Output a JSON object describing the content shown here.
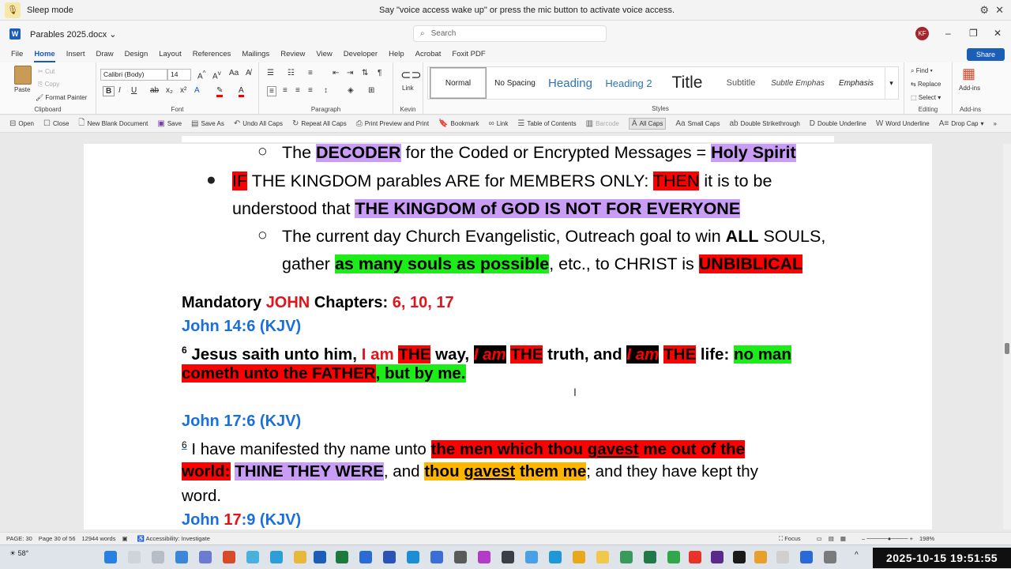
{
  "voice_access": {
    "status": "Sleep mode",
    "message": "Say \"voice access wake up\" or press the mic button to activate voice access."
  },
  "title_bar": {
    "filename": "Parables 2025.docx",
    "search_placeholder": "Search",
    "avatar": "KF"
  },
  "menu": [
    "File",
    "Home",
    "Insert",
    "Draw",
    "Design",
    "Layout",
    "References",
    "Mailings",
    "Review",
    "View",
    "Developer",
    "Help",
    "Acrobat",
    "Foxit PDF"
  ],
  "share": "Share",
  "ribbon": {
    "clipboard": {
      "paste": "Paste",
      "cut": "Cut",
      "copy": "Copy",
      "format_painter": "Format Painter",
      "label": "Clipboard"
    },
    "font": {
      "family": "Calibri (Body)",
      "size": "14",
      "label": "Font"
    },
    "paragraph": {
      "label": "Paragraph"
    },
    "kevin": {
      "link": "Link",
      "label": "Kevin"
    },
    "styles": {
      "items": [
        "Normal",
        "No Spacing",
        "Heading",
        "Heading 2",
        "Title",
        "Subtitle",
        "Subtle Emphas",
        "Emphasis"
      ],
      "label": "Styles"
    },
    "editing": {
      "find": "Find",
      "replace": "Replace",
      "select": "Select",
      "label": "Editing"
    },
    "addins": {
      "button": "Add-ins",
      "label": "Add-ins"
    }
  },
  "quick_access": [
    "Open",
    "Close",
    "New Blank Document",
    "Save",
    "Save As",
    "Undo All Caps",
    "Repeat All Caps",
    "Print Preview and Print",
    "Bookmark",
    "Link",
    "Table of Contents",
    "Barcode",
    "All Caps",
    "Small Caps",
    "Double Strikethrough",
    "Double Underline",
    "Word Underline",
    "Drop Cap"
  ],
  "document": {
    "line1": {
      "a": "The ",
      "b": "DECODER",
      "c": " for the Coded or Encrypted Messages = ",
      "d": "Holy Spirit"
    },
    "line2": {
      "a": "IF",
      "b": " THE KINGDOM parables ARE for MEMBERS ONLY: ",
      "c": "THEN",
      "d": " it is to be"
    },
    "line3": {
      "a": "understood that ",
      "b": "THE KINGDOM of GOD IS NOT FOR EVERYONE"
    },
    "line4": {
      "a": "The current day Church Evangelistic, Outreach goal to win ",
      "b": "ALL",
      "c": " SOULS,"
    },
    "line5": {
      "a": "gather ",
      "b": "as many souls as possible",
      "c": ", etc., to CHRIST is ",
      "d": "UNBIBLICAL"
    },
    "mandatory": {
      "a": "Mandatory ",
      "b": "JOHN",
      "c": " Chapters: ",
      "d": "6, 10, 17"
    },
    "ref1": "John 14:6 (KJV)",
    "verse6": {
      "num": "6",
      "a": " Jesus saith unto him, ",
      "b": "I am",
      "c": " ",
      "d": "THE",
      "e": " way, ",
      "f": "I am",
      "g": " ",
      "h": "THE",
      "i": " truth, and ",
      "j": "I am",
      "k": " ",
      "l": "THE",
      "m": " life: ",
      "n": "no man"
    },
    "verse6b": {
      "a": "cometh unto the FATHER",
      "b": ", but by me."
    },
    "ref2": {
      "a": "John ",
      "b": "17",
      "c": ":6 (KJV)"
    },
    "verse17": {
      "num": "6",
      "a": " I have manifested thy name unto ",
      "b": "the men which thou ",
      "c": "gavest",
      "d": " me out of the"
    },
    "verse17b": {
      "a": "world:",
      "b": " ",
      "c": "THINE THEY WERE",
      "d": ", and ",
      "e": "thou ",
      "f": "gavest",
      "g": " them me",
      "h": "; and they have kept thy"
    },
    "verse17c": "word.",
    "ref3": {
      "a": "John ",
      "b": "17",
      "c": ":9 (KJV)"
    }
  },
  "status": {
    "page": "PAGE: 30",
    "page_of": "Page 30 of 56",
    "words": "12944 words",
    "accessibility": "Accessibility: Investigate",
    "focus": "Focus",
    "zoom": "198%"
  },
  "taskbar": {
    "weather": "58°",
    "clock": "2025-10-15  19:51:55"
  }
}
